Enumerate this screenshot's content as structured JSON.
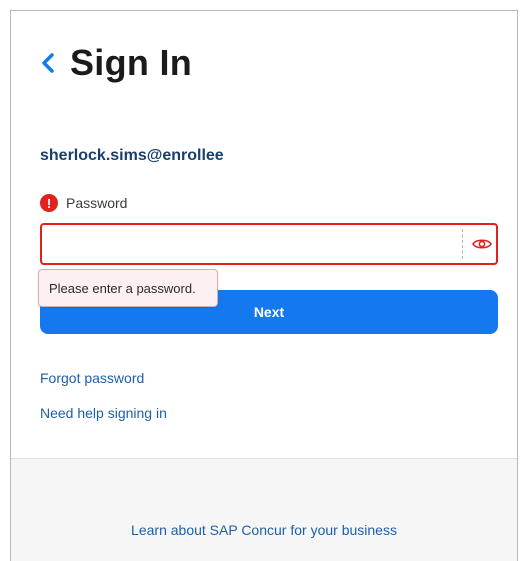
{
  "header": {
    "title": "Sign In",
    "back_icon": "chevron-left-icon"
  },
  "account": {
    "email": "sherlock.sims@enrollee"
  },
  "password": {
    "label": "Password",
    "value": "",
    "error_icon": "error-icon",
    "toggle_icon": "eye-icon",
    "error_message": "Please enter a password."
  },
  "actions": {
    "next_label": "Next"
  },
  "links": {
    "forgot_password": "Forgot password",
    "need_help": "Need help signing in"
  },
  "footer": {
    "learn_more": "Learn about SAP Concur for your business"
  },
  "colors": {
    "primary": "#1479ee",
    "error": "#e0211d",
    "link": "#1e5fa8"
  }
}
